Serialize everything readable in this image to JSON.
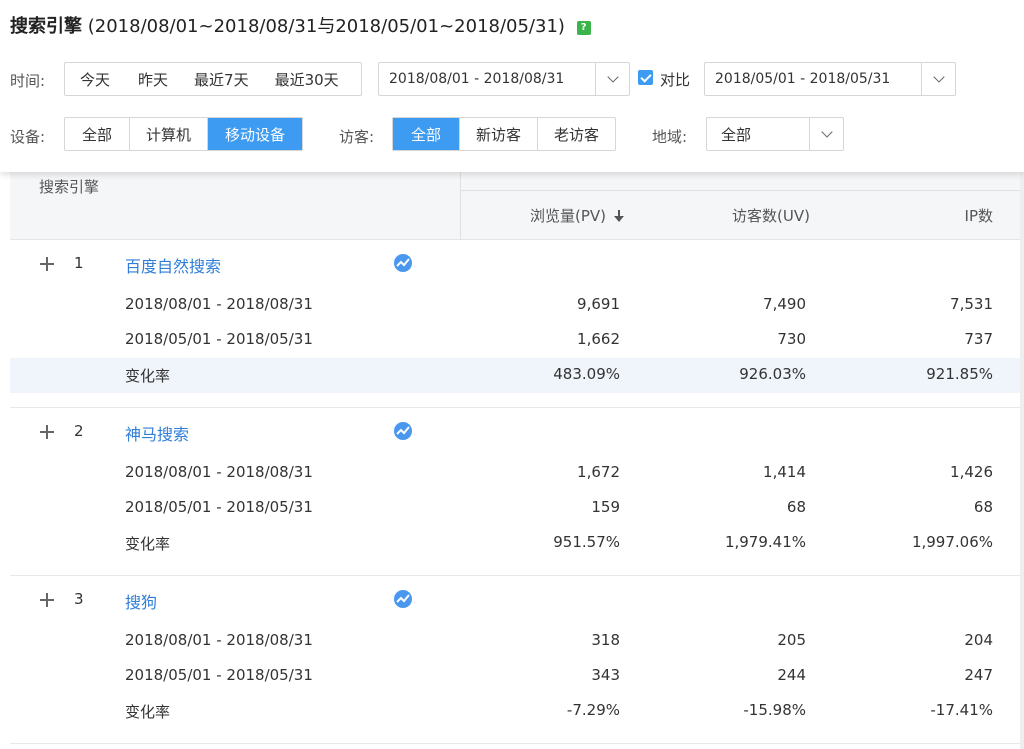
{
  "header": {
    "title": "搜索引擎",
    "title_range": "(2018/08/01~2018/08/31与2018/05/01~2018/05/31)",
    "help": "?"
  },
  "filters": {
    "time_label": "时间:",
    "time_buttons": [
      "今天",
      "昨天",
      "最近7天",
      "最近30天"
    ],
    "date_range": "2018/08/01 - 2018/08/31",
    "compare_label": "对比",
    "compare_checked": true,
    "compare_range": "2018/05/01 - 2018/05/31",
    "device_label": "设备:",
    "device_buttons": [
      "全部",
      "计算机",
      "移动设备"
    ],
    "device_active": "移动设备",
    "visitor_label": "访客:",
    "visitor_buttons": [
      "全部",
      "新访客",
      "老访客"
    ],
    "visitor_active": "全部",
    "region_label": "地域:",
    "region_value": "全部"
  },
  "table": {
    "columns": {
      "name": "搜索引擎",
      "pv": "浏览量(PV)",
      "uv": "访客数(UV)",
      "ip": "IP数"
    },
    "sorted_by": "pv",
    "groups": [
      {
        "index": "1",
        "name": "百度自然搜索",
        "rows": [
          {
            "label": "2018/08/01 - 2018/08/31",
            "pv": "9,691",
            "uv": "7,490",
            "ip": "7,531"
          },
          {
            "label": "2018/05/01 - 2018/05/31",
            "pv": "1,662",
            "uv": "730",
            "ip": "737"
          },
          {
            "label": "变化率",
            "pv": "483.09%",
            "uv": "926.03%",
            "ip": "921.85%"
          }
        ]
      },
      {
        "index": "2",
        "name": "神马搜索",
        "rows": [
          {
            "label": "2018/08/01 - 2018/08/31",
            "pv": "1,672",
            "uv": "1,414",
            "ip": "1,426"
          },
          {
            "label": "2018/05/01 - 2018/05/31",
            "pv": "159",
            "uv": "68",
            "ip": "68"
          },
          {
            "label": "变化率",
            "pv": "951.57%",
            "uv": "1,979.41%",
            "ip": "1,997.06%"
          }
        ]
      },
      {
        "index": "3",
        "name": "搜狗",
        "rows": [
          {
            "label": "2018/08/01 - 2018/08/31",
            "pv": "318",
            "uv": "205",
            "ip": "204"
          },
          {
            "label": "2018/05/01 - 2018/05/31",
            "pv": "343",
            "uv": "244",
            "ip": "247"
          },
          {
            "label": "变化率",
            "pv": "-7.29%",
            "uv": "-15.98%",
            "ip": "-17.41%"
          }
        ]
      }
    ]
  },
  "colors": {
    "accent": "#3d9bf2",
    "link": "#2f7ed8",
    "help_icon": "#3bb54a"
  }
}
